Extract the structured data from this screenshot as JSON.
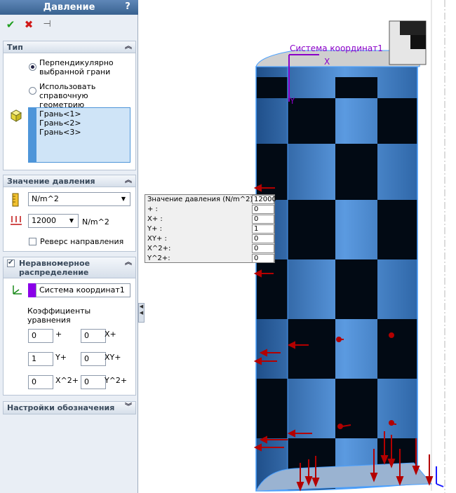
{
  "panel": {
    "title": "Давление",
    "help": "?",
    "toolbar": {
      "ok": "✔",
      "cancel": "✖",
      "pin": "⊣"
    },
    "type_group": {
      "header": "Тип",
      "option1": "Перпендикулярно\nвыбранной грани",
      "option2": "Использовать\nсправочную геометрию",
      "faces": [
        "Грань<1>",
        "Грань<2>",
        "Грань<3>"
      ]
    },
    "value_group": {
      "header": "Значение давления",
      "unit_select": "N/m^2",
      "value": "12000",
      "value_unit": "N/m^2",
      "reverse": "Реверс направления"
    },
    "nonuniform_group": {
      "header": "Неравномерное распределение",
      "coord_system": "Система координат1",
      "coef_label": "Коэффициенты уравнения",
      "coefs": [
        {
          "value": "0",
          "label": "+"
        },
        {
          "value": "0",
          "label": "X+"
        },
        {
          "value": "1",
          "label": "Y+"
        },
        {
          "value": "0",
          "label": "XY+"
        },
        {
          "value": "0",
          "label": "X^2+"
        },
        {
          "value": "0",
          "label": "Y^2+"
        }
      ]
    },
    "symbol_group": {
      "header": "Настройки обозначения"
    }
  },
  "viewport": {
    "coord_label": "Система координат1",
    "axis_x": "X",
    "axis_y": "Y"
  },
  "coef_table": {
    "rows": [
      {
        "label": "Значение давления (N/m^2):",
        "value": "12000"
      },
      {
        "label": "+   :",
        "value": "0"
      },
      {
        "label": "X+  :",
        "value": "0"
      },
      {
        "label": "Y+  :",
        "value": "1"
      },
      {
        "label": "XY+ :",
        "value": "0"
      },
      {
        "label": "X^2+:",
        "value": "0"
      },
      {
        "label": "Y^2+:",
        "value": "0"
      }
    ]
  },
  "colors": {
    "title_bar": "#38628f",
    "face_blue": "#3a7fc8",
    "arrow_red": "#b30000",
    "coord_purple": "#8a00c8"
  }
}
